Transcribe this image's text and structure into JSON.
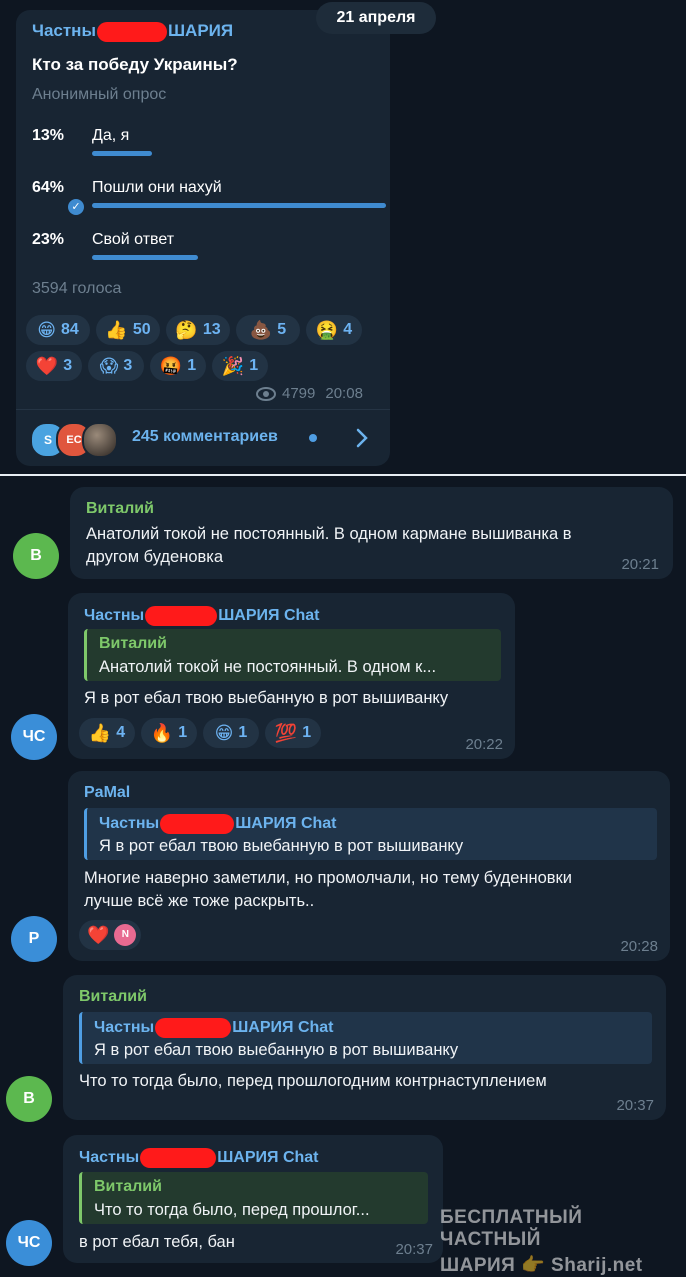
{
  "date_chip": "21 апреля",
  "post": {
    "sender_pre": "Частны",
    "sender_post": "ШАРИЯ",
    "question": "Кто за победу Украины?",
    "poll_type": "Анонимный опрос",
    "options": [
      {
        "percent": "13%",
        "label": "Да, я",
        "fraction": 0.13
      },
      {
        "percent": "64%",
        "label": "Пошли они нахуй",
        "fraction": 0.64,
        "selected": true
      },
      {
        "percent": "23%",
        "label": "Свой ответ",
        "fraction": 0.23
      }
    ],
    "votes": "3594 голоса",
    "reactions": [
      {
        "emoji": "😁",
        "count": "84"
      },
      {
        "emoji": "👍",
        "count": "50"
      },
      {
        "emoji": "🤔",
        "count": "13"
      },
      {
        "emoji": "💩",
        "count": "5"
      },
      {
        "emoji": "🤮",
        "count": "4"
      },
      {
        "emoji": "❤️",
        "count": "3"
      },
      {
        "emoji": "😱",
        "count": "3"
      },
      {
        "emoji": "🤬",
        "count": "1"
      },
      {
        "emoji": "🎉",
        "count": "1"
      }
    ],
    "views": "4799",
    "time": "20:08",
    "comment_avatars": [
      "S",
      "EC"
    ],
    "comments": "245 комментариев"
  },
  "messages": [
    {
      "avatar": "В",
      "avatar_color": "#5cb84f",
      "name": "Виталий",
      "text_lines": [
        "Анатолий токой не постоянный. В одном кармане вышиванка в",
        "другом буденовка"
      ],
      "time": "20:21"
    },
    {
      "avatar": "ЧС",
      "avatar_color": "#3a8ed8",
      "name_pre": "Частны",
      "name_post": "ШАРИЯ Chat",
      "reply_name": "Виталий",
      "reply_text": "Анатолий токой не постоянный. В одном к...",
      "text_lines": [
        "Я в рот ебал твою выебанную в рот вышиванку"
      ],
      "reactions": [
        {
          "emoji": "👍",
          "count": "4"
        },
        {
          "emoji": "🔥",
          "count": "1"
        },
        {
          "emoji": "😁",
          "count": "1"
        },
        {
          "emoji": "💯",
          "count": "1"
        }
      ],
      "time": "20:22"
    },
    {
      "avatar": "P",
      "avatar_color": "#3a8ed8",
      "name": "PaMal",
      "reply_name_pre": "Частны",
      "reply_name_post": "ШАРИЯ Chat",
      "reply_text": "Я в рот ебал твою выебанную в рот вышиванку",
      "text_lines": [
        "Многие наверно заметили, но промолчали, но тему буденновки",
        "лучше всё же тоже раскрыть.."
      ],
      "reaction_emoji": "❤️",
      "reaction_avatar": "N",
      "time": "20:28"
    },
    {
      "avatar": "В",
      "avatar_color": "#5cb84f",
      "name": "Виталий",
      "reply_name_pre": "Частны",
      "reply_name_post": "ШАРИЯ Chat",
      "reply_text": "Я в рот ебал твою выебанную в рот вышиванку",
      "text_lines": [
        "Что то тогда было, перед прошлогодним контрнаступлением"
      ],
      "time": "20:37"
    },
    {
      "avatar": "ЧС",
      "avatar_color": "#3a8ed8",
      "name_pre": "Частны",
      "name_post": "ШАРИЯ Chat",
      "reply_name": "Виталий",
      "reply_text": "Что то тогда было, перед прошлог...",
      "text_lines": [
        "в рот ебал тебя, бан"
      ],
      "time": "20:37"
    }
  ],
  "watermark": {
    "line1": "БЕСПЛАТНЫЙ ЧАСТНЫЙ",
    "line2_left": "ШАРИЯ",
    "line2_right": "Sharij.net",
    "hand_emoji": "👉"
  }
}
